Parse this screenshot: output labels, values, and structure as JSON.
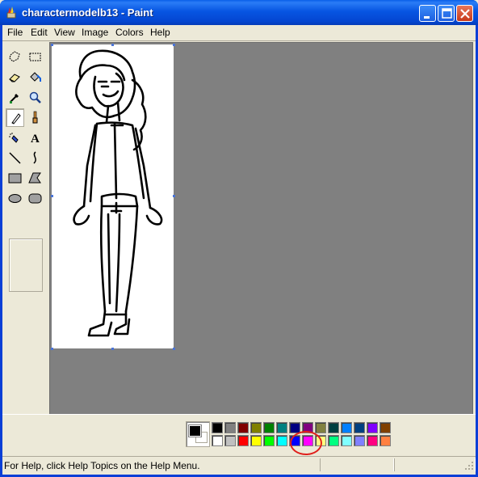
{
  "window": {
    "title": "charactermodelb13 - Paint",
    "icon": "paint-app-icon",
    "controls": [
      "minimize-icon",
      "maximize-icon",
      "close-icon"
    ]
  },
  "menu": {
    "items": [
      "File",
      "Edit",
      "View",
      "Image",
      "Colors",
      "Help"
    ]
  },
  "toolbox": {
    "tools": [
      {
        "name": "free-form-select"
      },
      {
        "name": "rect-select"
      },
      {
        "name": "eraser"
      },
      {
        "name": "fill-with-color"
      },
      {
        "name": "pick-color"
      },
      {
        "name": "magnifier"
      },
      {
        "name": "pencil",
        "active": true
      },
      {
        "name": "brush"
      },
      {
        "name": "airbrush"
      },
      {
        "name": "text"
      },
      {
        "name": "line"
      },
      {
        "name": "curve"
      },
      {
        "name": "rectangle"
      },
      {
        "name": "polygon"
      },
      {
        "name": "ellipse"
      },
      {
        "name": "rounded-rectangle"
      }
    ],
    "text_tool_glyph": "A"
  },
  "palette": {
    "foreground": "#000000",
    "background": "#ffffff",
    "row1": [
      "#000000",
      "#808080",
      "#800000",
      "#808000",
      "#008000",
      "#008080",
      "#000080",
      "#800080",
      "#808040",
      "#004040",
      "#0080ff",
      "#004080",
      "#8000ff",
      "#804000"
    ],
    "row2": [
      "#ffffff",
      "#c0c0c0",
      "#ff0000",
      "#ffff00",
      "#00ff00",
      "#00ffff",
      "#0000ff",
      "#ff00ff",
      "#ffff80",
      "#00ff80",
      "#80ffff",
      "#8080ff",
      "#ff0080",
      "#ff8040"
    ],
    "highlighted": "#ff00ff"
  },
  "status": {
    "help_text": "For Help, click Help Topics on the Help Menu."
  }
}
